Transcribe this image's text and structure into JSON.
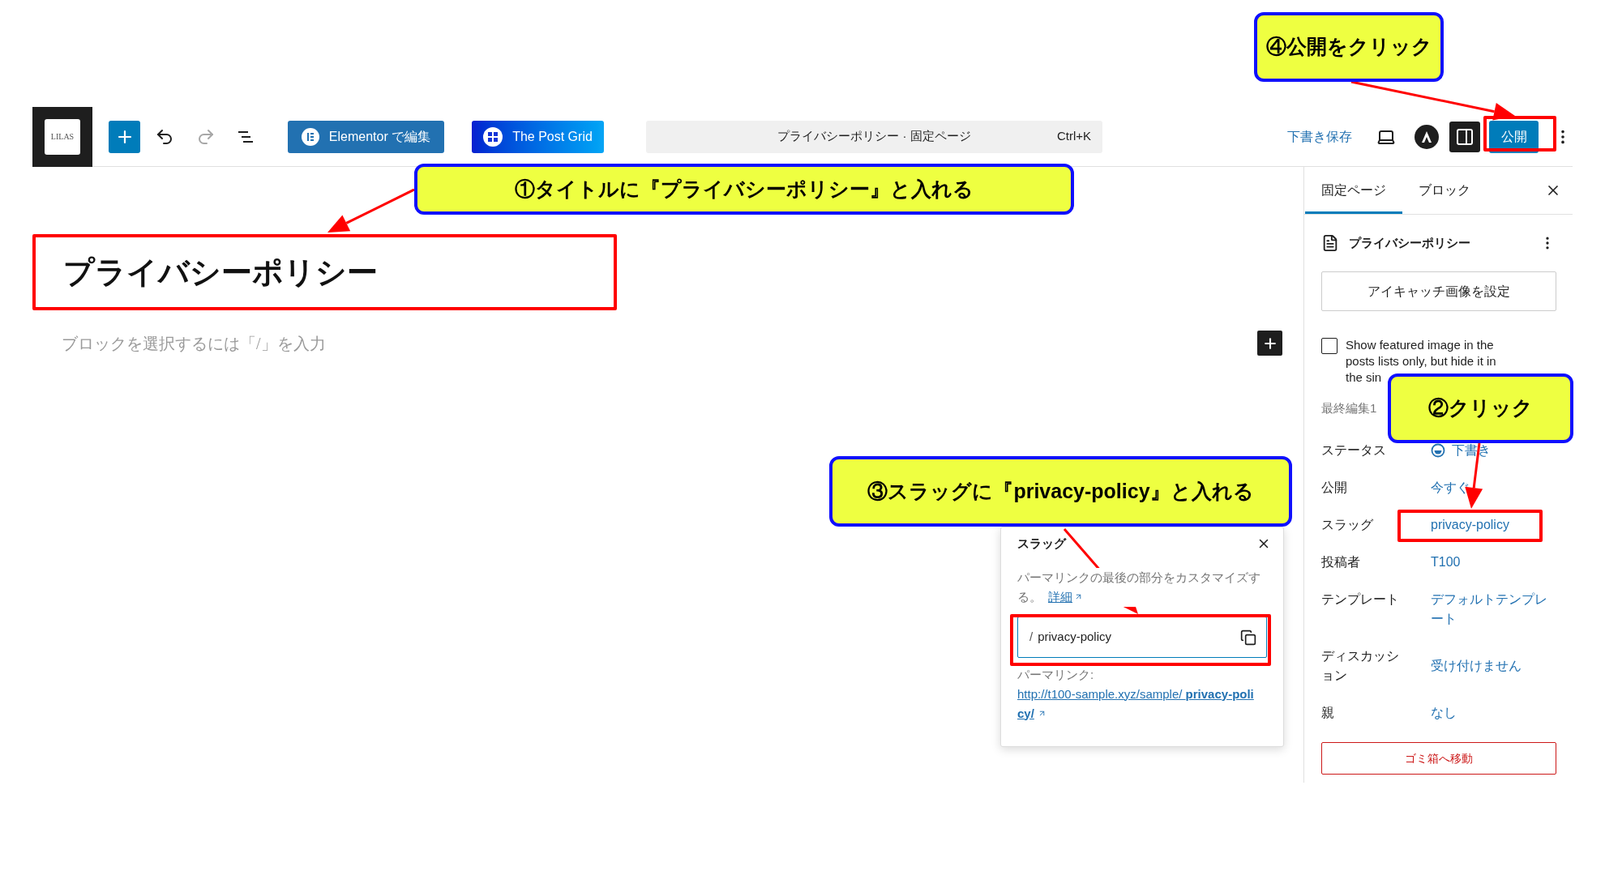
{
  "toolbar": {
    "logo_text": "LILAS",
    "tools": [
      {
        "kind": "add",
        "disabled": false
      },
      {
        "kind": "undo",
        "disabled": false
      },
      {
        "kind": "redo",
        "disabled": true
      },
      {
        "kind": "outline",
        "disabled": false
      }
    ],
    "elementor_button": "Elementor で編集",
    "post_grid_button": "The Post Grid",
    "command_bar": {
      "title": "プライバシーポリシー · 固定ページ",
      "shortcut": "Ctrl+K"
    },
    "save_draft": "下書き保存",
    "publish_button": "公開",
    "settings_open": true
  },
  "editor": {
    "title": "プライバシーポリシー",
    "block_placeholder": "ブロックを選択するには「/」を入力"
  },
  "sidebar": {
    "tabs": [
      {
        "label": "固定ページ",
        "selected": true
      },
      {
        "label": "ブロック",
        "selected": false
      }
    ],
    "page_title": "プライバシーポリシー",
    "featured_image_button": "アイキャッチ画像を設定",
    "featured_checkbox": {
      "label": "Show featured image in the posts lists only, but hide it in the sin",
      "checked": false
    },
    "last_edited": "最終編集1",
    "fields": [
      {
        "label": "ステータス",
        "value": "下書き",
        "kind": "status"
      },
      {
        "label": "公開",
        "value": "今すぐ",
        "kind": "link"
      },
      {
        "label": "スラッグ",
        "value": "privacy-policy",
        "kind": "link"
      },
      {
        "label": "投稿者",
        "value": "T100",
        "kind": "link"
      },
      {
        "label": "テンプレート",
        "value": "デフォルトテンプレート",
        "kind": "link"
      },
      {
        "label": "ディスカッション",
        "value": "受け付けません",
        "kind": "link"
      },
      {
        "label": "親",
        "value": "なし",
        "kind": "link"
      }
    ],
    "trash_button": "ゴミ箱へ移動"
  },
  "slug_popover": {
    "title": "スラッグ",
    "description": "パーマリンクの最後の部分をカスタマイズする。",
    "learn_more": "詳細",
    "prefix": "/",
    "value": "privacy-policy",
    "permalink_label": "パーマリンク:",
    "permalink": "http://t100-sample.xyz/sample/ **privacy-policy/**"
  },
  "annotations": [
    {
      "text": "①タイトルに『プライバシーポリシー』と入れる"
    },
    {
      "text": "②クリック"
    },
    {
      "text": "③スラッグに『privacy-policy』と入れる"
    },
    {
      "text": "④公開をクリック"
    }
  ]
}
